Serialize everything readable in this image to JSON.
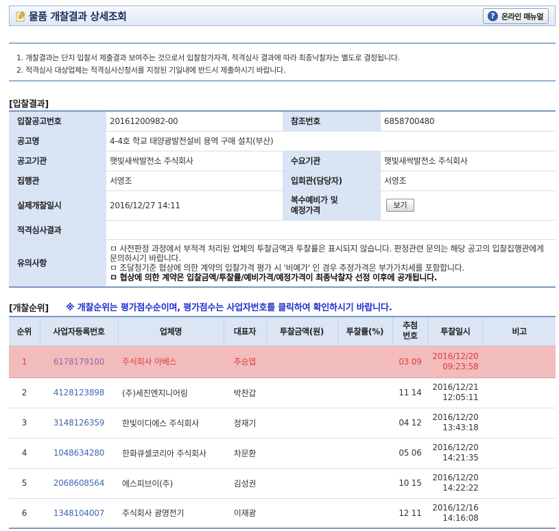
{
  "header": {
    "title": "물품 개찰결과 상세조회",
    "manual_label": "온라인 매뉴얼"
  },
  "notice": {
    "lines": [
      "1.  개찰결과는 단지 입찰서 제출결과 보여주는 것으로서 입찰참가자격, 적격심사 결과에 따라 최종낙찰자는 별도로 결정됩니다.",
      "2.  적격심사 대상업체는 적격심사신청서를 지정된 기일내에 반드시 제출하시기 바랍니다."
    ]
  },
  "bid_result": {
    "section_label": "[입찰결과]",
    "rows": {
      "notice_no_label": "입찰공고번호",
      "notice_no": "20161200982-00",
      "ref_no_label": "참조번호",
      "ref_no": "6858700480",
      "notice_name_label": "공고명",
      "notice_name": "4-4호 학교 태양광발전설비 용역 구매 설치(부산)",
      "agency_label": "공고기관",
      "agency": "햇빛새싹발전소 주식회사",
      "demand_label": "수요기관",
      "demand": "햇빛새싹발전소 주식회사",
      "executor_label": "집행관",
      "executor": "서영조",
      "attendee_label": "입회관(담당자)",
      "attendee": "서영조",
      "open_date_label": "실제개찰일시",
      "open_date": "2016/12/27 14:11",
      "price_label_1": "복수예비가 및",
      "price_label_2": "예정가격",
      "view_button": "보기",
      "qual_label": "적격심사결과",
      "qual": "",
      "caution_label": "유의사항",
      "caution_1": "ㅁ 사전판정 과정에서 부적격 처리된 업체의 투찰금액과 투찰률은 표시되지 않습니다. 판정관련 문의는 해당 공고의 입찰집행관에게 문의하시기 바랍니다.",
      "caution_2": "ㅁ 조달청기준 협상에 의한 계약의 입찰가격 평가 시 '비예가' 인 경우 추정가격은 부가가치세를 포함합니다.",
      "caution_3": "ㅁ 협상에 의한 계약은 입찰금액/투찰률/예비가격/예정가격이 최종낙찰자 선정 이후에 공개됩니다."
    }
  },
  "ranking": {
    "section_label": "[개찰순위]",
    "note": "※ 개찰순위는 평가점수순이며, 평가점수는 사업자번호를 클릭하여 확인하시기 바랍니다.",
    "columns": [
      "순위",
      "사업자등록번호",
      "업체명",
      "대표자",
      "투찰금액(원)",
      "투찰률(%)",
      "추첨",
      "번호",
      "투찰일시",
      "비고"
    ],
    "rows": [
      {
        "rank": "1",
        "biz_no": "6178179100",
        "company": "주식회사 아베스",
        "ceo": "추승엽",
        "amount": "",
        "rate": "",
        "draw": "03 09",
        "date": "2016/12/20",
        "time": "09:23:58",
        "remark": ""
      },
      {
        "rank": "2",
        "biz_no": "4128123898",
        "company": "(주)세진엔지니어링",
        "ceo": "박찬갑",
        "amount": "",
        "rate": "",
        "draw": "11 14",
        "date": "2016/12/21",
        "time": "12:05:11",
        "remark": ""
      },
      {
        "rank": "3",
        "biz_no": "3148126359",
        "company": "한빛이디에스 주식회사",
        "ceo": "정재기",
        "amount": "",
        "rate": "",
        "draw": "04 12",
        "date": "2016/12/20",
        "time": "13:43:18",
        "remark": ""
      },
      {
        "rank": "4",
        "biz_no": "1048634280",
        "company": "한화큐셀코리아 주식회사",
        "ceo": "차문환",
        "amount": "",
        "rate": "",
        "draw": "05 06",
        "date": "2016/12/20",
        "time": "14:21:35",
        "remark": ""
      },
      {
        "rank": "5",
        "biz_no": "2068608564",
        "company": "에스피브이(주)",
        "ceo": "김성권",
        "amount": "",
        "rate": "",
        "draw": "10 15",
        "date": "2016/12/20",
        "time": "14:22:22",
        "remark": ""
      },
      {
        "rank": "6",
        "biz_no": "1348104007",
        "company": "주식회사 광명전기",
        "ceo": "이재광",
        "amount": "",
        "rate": "",
        "draw": "12 11",
        "date": "2016/12/16",
        "time": "14:16:08",
        "remark": ""
      }
    ]
  }
}
